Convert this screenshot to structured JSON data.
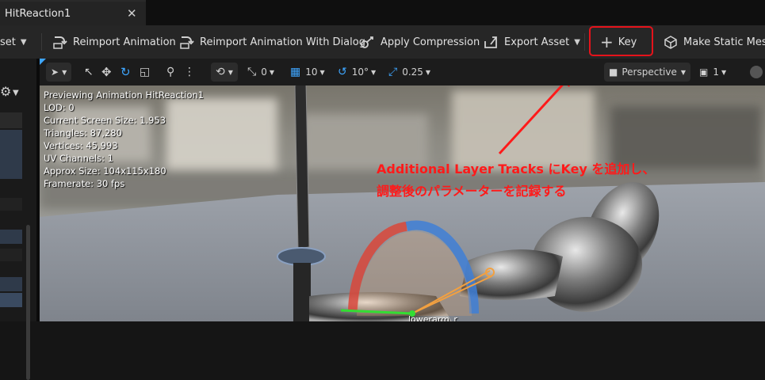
{
  "tab": {
    "title": "HitReaction1",
    "close": "✕"
  },
  "toolbar": {
    "asset_menu": "set",
    "reimport": "Reimport Animation",
    "reimport_dialog": "Reimport Animation With Dialog",
    "apply_compression": "Apply Compression",
    "export_asset": "Export Asset",
    "key": "Key",
    "make_static_mesh": "Make Static Mesh"
  },
  "viewport_toolbar": {
    "angle_snap": "0",
    "grid_snap": "10",
    "rotation_snap": "10°",
    "scale_snap": "0.25",
    "view_mode": "Perspective",
    "camera_speed": "1"
  },
  "stats": {
    "line1": "Previewing Animation HitReaction1",
    "line2": "LOD: 0",
    "line3": "Current Screen Size: 1.953",
    "line4": "Triangles: 87,280",
    "line5": "Vertices: 45,993",
    "line6": "UV Channels: 1",
    "line7": "Approx Size: 104x115x180",
    "line8": "Framerate: 30 fps"
  },
  "annotation": {
    "line1": "Additional Layer Tracks にKey を追加し、",
    "line2": "調整後のパラメーターを記録する",
    "color": "#ff1a1a"
  },
  "bone_label": "lowerarm_r",
  "colors": {
    "accent_blue": "#3ea6ff",
    "highlight_red": "#e5131b"
  }
}
